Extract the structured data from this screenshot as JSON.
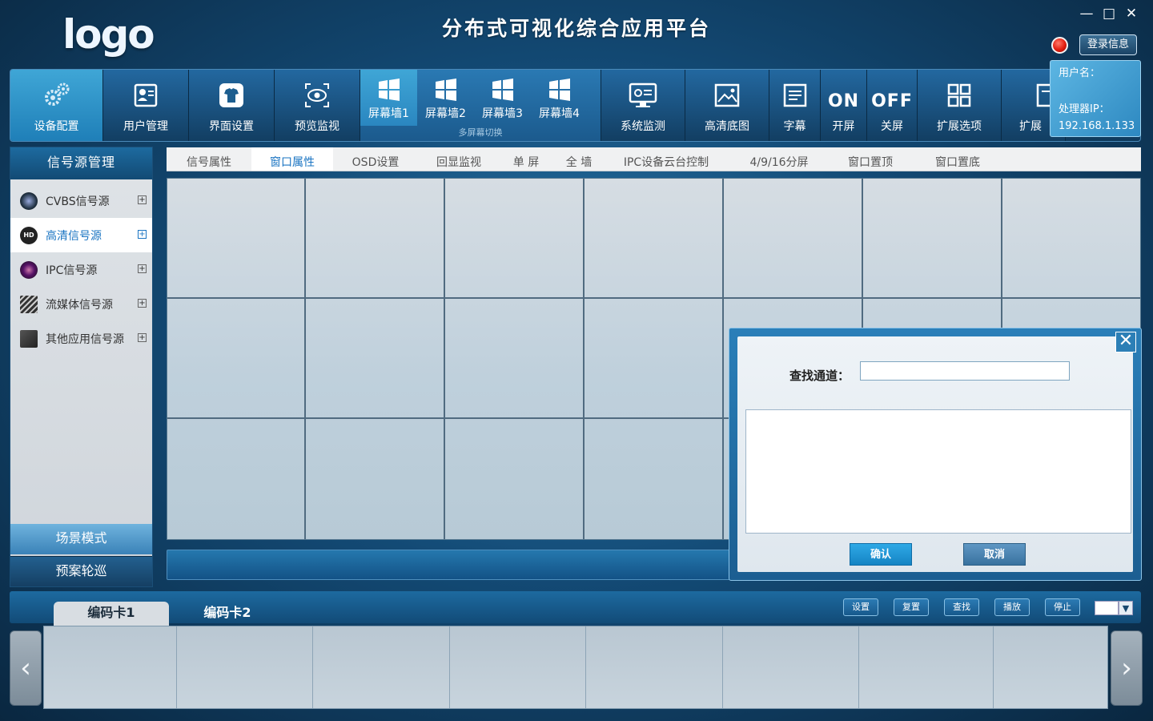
{
  "app": {
    "logo": "logo",
    "title": "分布式可视化综合应用平台",
    "window_controls": {
      "minimize": "—",
      "maximize": "□",
      "close": "✕"
    },
    "login_button": "登录信息"
  },
  "user_panel": {
    "username_label": "用户名：",
    "processor_ip_label": "处理器IP：",
    "processor_ip": "192.168.1.133"
  },
  "toolbar": {
    "device_config": "设备配置",
    "user_mgmt": "用户管理",
    "ui_settings": "界面设置",
    "preview_monitor": "预览监视",
    "screen_walls": [
      "屏幕墙1",
      "屏幕墙2",
      "屏幕墙3",
      "屏幕墙4"
    ],
    "screen_switch_caption": "多屏幕切换",
    "system_monitor": "系统监测",
    "hd_base": "高清底图",
    "subtitle": "字幕",
    "on_glyph": "ON",
    "on_label": "开屏",
    "off_glyph": "OFF",
    "off_label": "关屏",
    "ext_options": "扩展选项",
    "ext_truncated": "扩展"
  },
  "left_panel": {
    "header": "信号源管理",
    "sources": [
      {
        "label": "CVBS信号源",
        "icon": "camera-lens-icon",
        "expand": "+"
      },
      {
        "label": "高清信号源",
        "icon": "hd-icon",
        "expand": "+"
      },
      {
        "label": "IPC信号源",
        "icon": "ipc-camera-icon",
        "expand": "+"
      },
      {
        "label": "流媒体信号源",
        "icon": "clapper-icon",
        "expand": "+"
      },
      {
        "label": "其他应用信号源",
        "icon": "other-app-icon",
        "expand": "+"
      }
    ],
    "hd_badge": "HD",
    "scene_mode": "场景模式",
    "plan_tour": "预案轮巡"
  },
  "tabs": [
    {
      "label": "信号属性",
      "active": false
    },
    {
      "label": "窗口属性",
      "active": true
    },
    {
      "label": "OSD设置",
      "active": false
    },
    {
      "label": "回显监视",
      "active": false
    },
    {
      "label": "单  屏",
      "active": false
    },
    {
      "label": "全  墙",
      "active": false
    },
    {
      "label": "IPC设备云台控制",
      "active": false
    },
    {
      "label": "4/9/16分屏",
      "active": false
    },
    {
      "label": "窗口置顶",
      "active": false
    },
    {
      "label": "窗口置底",
      "active": false
    }
  ],
  "dialog": {
    "search_label": "查找通道：",
    "search_value": "",
    "confirm": "确认",
    "cancel": "取消",
    "close_glyph": "✕"
  },
  "bottom": {
    "card_tabs": [
      "编码卡1",
      "编码卡2"
    ],
    "buttons": [
      "设置",
      "复置",
      "查找",
      "播放",
      "停止"
    ],
    "select_arrow": "▼",
    "left_arrow": "‹",
    "right_arrow": "›"
  },
  "colors": {
    "accent": "#1a74c2",
    "toolbar_active": "#3fa6d6",
    "record_red": "#e11d0f"
  }
}
